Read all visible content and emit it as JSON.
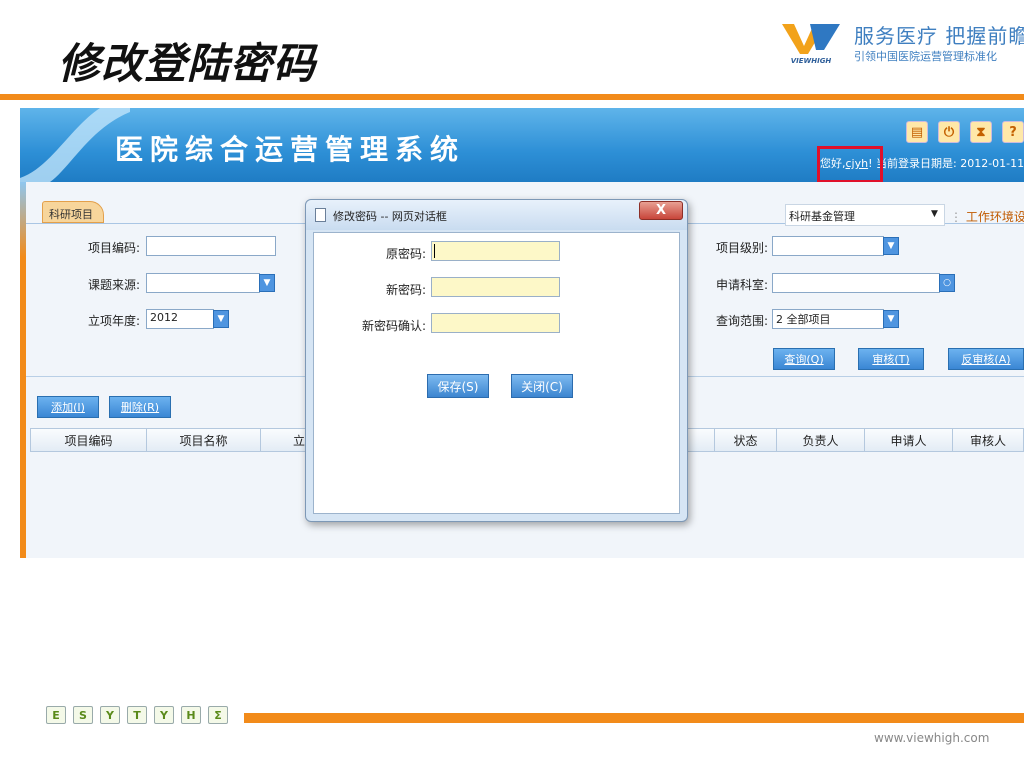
{
  "slide": {
    "title": "修改登陆密码",
    "slogan": "服务医疗 把握前瞻",
    "slogan_sub": "引领中国医院运营管理标准化",
    "logo_text": "VIEWHIGH",
    "footer_url": "www.viewhigh.com",
    "footer_icons": [
      "E",
      "S",
      "Y",
      "T",
      "Y",
      "H",
      "Σ"
    ]
  },
  "app": {
    "title": "医院综合运营管理系统",
    "header_icons": [
      "monitor-icon",
      "power-icon",
      "hourglass-icon",
      "help-icon"
    ],
    "header_icon_glyphs": [
      "▤",
      "⏻",
      "⧗",
      "?"
    ],
    "greeting_prefix": "您好,",
    "user": "cjyh",
    "greeting_suffix": "!",
    "login_date_label": "当前登录日期是: 2012-01-11",
    "tab": "科研项目",
    "module_select": "科研基金管理",
    "work_env": "工作环境设置",
    "form": {
      "project_code_label": "项目编码:",
      "topic_source_label": "课题来源:",
      "year_label": "立项年度:",
      "year_value": "2012",
      "level_label": "项目级别:",
      "dept_label": "申请科室:",
      "scope_label": "查询范围:",
      "scope_value": "2  全部项目"
    },
    "buttons": {
      "query": "查询(Q)",
      "audit": "审核(T)",
      "unaudit": "反审核(A)",
      "add": "添加(I)",
      "delete": "删除(R)"
    },
    "table_columns_left": [
      "项目编码",
      "项目名称",
      "立"
    ],
    "table_columns_right": [
      "状态",
      "负责人",
      "申请人",
      "审核人"
    ]
  },
  "dialog": {
    "title": "修改密码 -- 网页对话框",
    "close_glyph": "X",
    "old_password_label": "原密码:",
    "new_password_label": "新密码:",
    "confirm_password_label": "新密码确认:",
    "save_button": "保存(S)",
    "close_button": "关闭(C)"
  },
  "colors": {
    "accent_orange": "#f28b1a",
    "header_blue": "#2d8fd6",
    "highlight_red": "#e0102a",
    "input_yellow": "#fdf8c8"
  }
}
